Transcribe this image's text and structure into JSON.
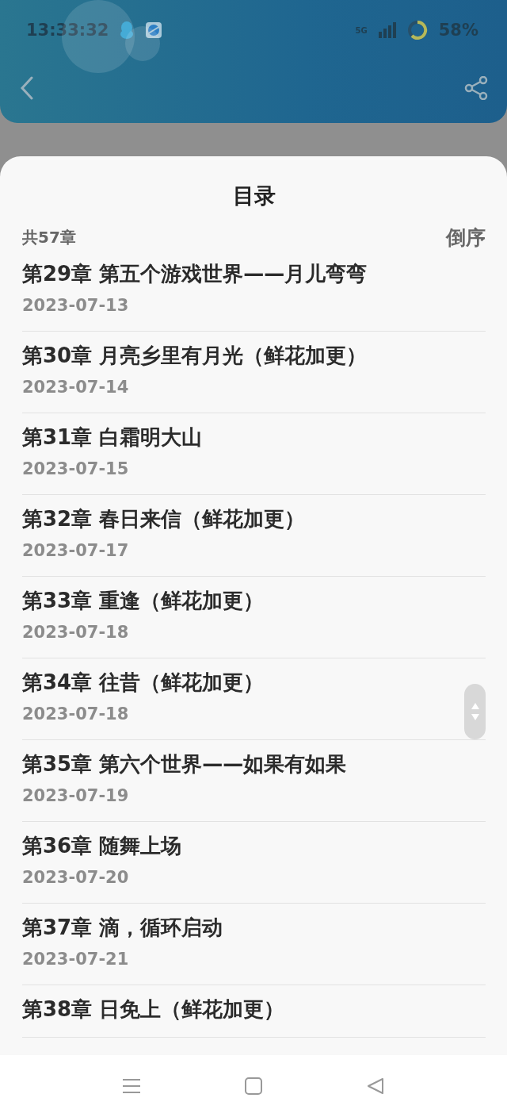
{
  "status_bar": {
    "time": "13:33:32",
    "network": "5G",
    "battery": "58%"
  },
  "sheet": {
    "title": "目录",
    "count": "共57章",
    "sort": "倒序",
    "chapters": [
      {
        "title": "第29章 第五个游戏世界——月儿弯弯",
        "date": "2023-07-13"
      },
      {
        "title": "第30章 月亮乡里有月光（鲜花加更）",
        "date": "2023-07-14"
      },
      {
        "title": "第31章 白霜明大山",
        "date": "2023-07-15"
      },
      {
        "title": "第32章 春日来信（鲜花加更）",
        "date": "2023-07-17"
      },
      {
        "title": "第33章 重逢（鲜花加更）",
        "date": "2023-07-18"
      },
      {
        "title": "第34章 往昔（鲜花加更）",
        "date": "2023-07-18"
      },
      {
        "title": "第35章 第六个世界——如果有如果",
        "date": "2023-07-19"
      },
      {
        "title": "第36章 随舞上场",
        "date": "2023-07-20"
      },
      {
        "title": "第37章 滴，循环启动",
        "date": "2023-07-21"
      },
      {
        "title": "第38章 日免上（鲜花加更）"
      }
    ]
  }
}
